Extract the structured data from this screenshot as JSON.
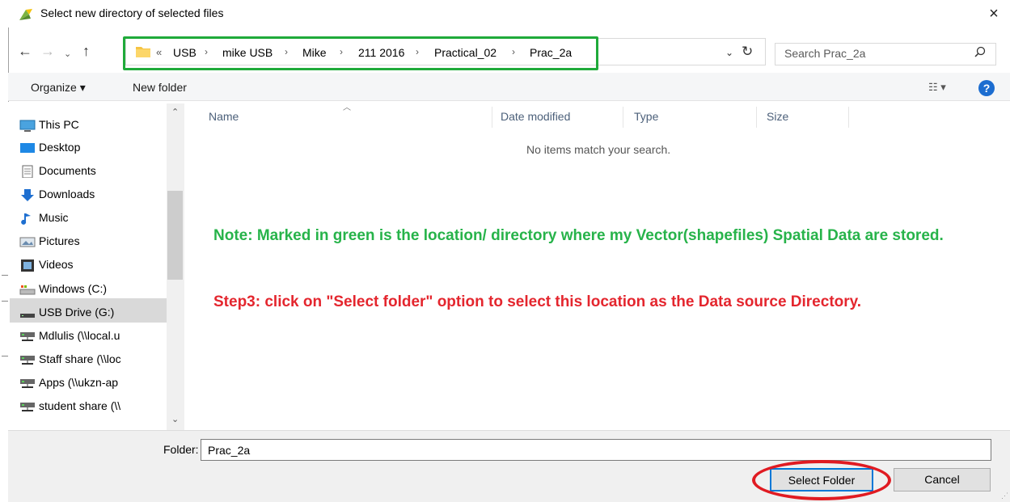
{
  "window": {
    "title": "Select new directory of selected files",
    "close_label": "×"
  },
  "address_bar": {
    "overflow_label": "«",
    "crumbs": [
      "USB",
      "mike USB",
      "Mike",
      "211 2016",
      "Practical_02",
      "Prac_2a"
    ],
    "separator": "›"
  },
  "search": {
    "placeholder": "Search Prac_2a"
  },
  "toolbar": {
    "organize_label": "Organize ▾",
    "new_folder_label": "New folder",
    "view_label": "☷ ▾",
    "help_label": "?"
  },
  "nav_pane": {
    "items": [
      {
        "label": "This PC",
        "icon": "pc-icon"
      },
      {
        "label": "Desktop",
        "icon": "desktop-icon"
      },
      {
        "label": "Documents",
        "icon": "documents-icon"
      },
      {
        "label": "Downloads",
        "icon": "downloads-icon"
      },
      {
        "label": "Music",
        "icon": "music-icon"
      },
      {
        "label": "Pictures",
        "icon": "pictures-icon"
      },
      {
        "label": "Videos",
        "icon": "videos-icon"
      },
      {
        "label": "Windows (C:)",
        "icon": "drive-icon"
      },
      {
        "label": "USB Drive (G:)",
        "icon": "usb-drive-icon",
        "selected": true
      },
      {
        "label": "Mdlulis (\\\\local.u",
        "icon": "network-drive-icon"
      },
      {
        "label": "Staff share (\\\\loc",
        "icon": "network-drive-icon"
      },
      {
        "label": "Apps (\\\\ukzn-ap",
        "icon": "network-drive-icon"
      },
      {
        "label": "student share (\\\\",
        "icon": "network-drive-icon"
      }
    ]
  },
  "file_list": {
    "columns": [
      "Name",
      "Date modified",
      "Type",
      "Size"
    ],
    "empty_message": "No items match your search."
  },
  "annotations": {
    "note_green": "Note: Marked in green is the location/ directory where my Vector(shapefiles) Spatial Data are stored.",
    "note_red": "Step3: click on \"Select folder\" option to select this location as the Data source Directory.",
    "green_color": "#27b34a",
    "red_color": "#e4262e"
  },
  "footer": {
    "folder_label": "Folder:",
    "folder_value": "Prac_2a",
    "select_button": "Select Folder",
    "cancel_button": "Cancel"
  }
}
